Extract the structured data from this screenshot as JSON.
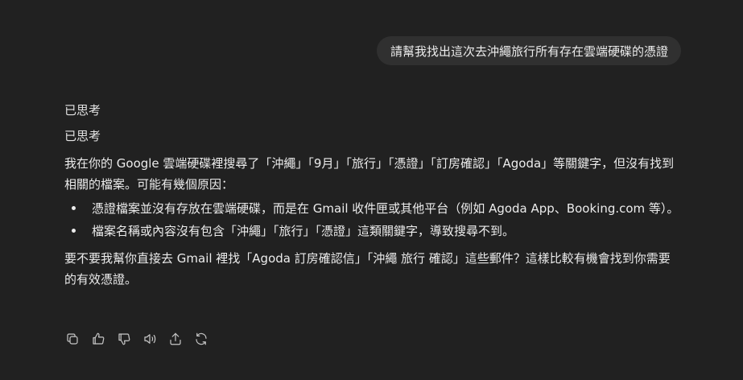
{
  "user_message": "請幫我找出這次去沖繩旅行所有存在雲端硬碟的憑證",
  "assistant": {
    "thought_1": "已思考",
    "thought_2": "已思考",
    "intro": "我在你的 Google 雲端硬碟裡搜尋了「沖繩」「9月」「旅行」「憑證」「訂房確認」「Agoda」等關鍵字，但沒有找到相關的檔案。可能有幾個原因：",
    "bullets": [
      "憑證檔案並沒有存放在雲端硬碟，而是在 Gmail 收件匣或其他平台（例如 Agoda App、Booking.com 等）。",
      "檔案名稱或內容沒有包含「沖繩」「旅行」「憑證」這類關鍵字，導致搜尋不到。"
    ],
    "closing": "要不要我幫你直接去 Gmail 裡找「Agoda 訂房確認信」「沖繩 旅行 確認」這些郵件？這樣比較有機會找到你需要的有效憑證。"
  },
  "actions": {
    "icons": [
      "copy-icon",
      "thumbs-up-icon",
      "thumbs-down-icon",
      "read-aloud-icon",
      "share-icon",
      "regenerate-icon"
    ]
  }
}
